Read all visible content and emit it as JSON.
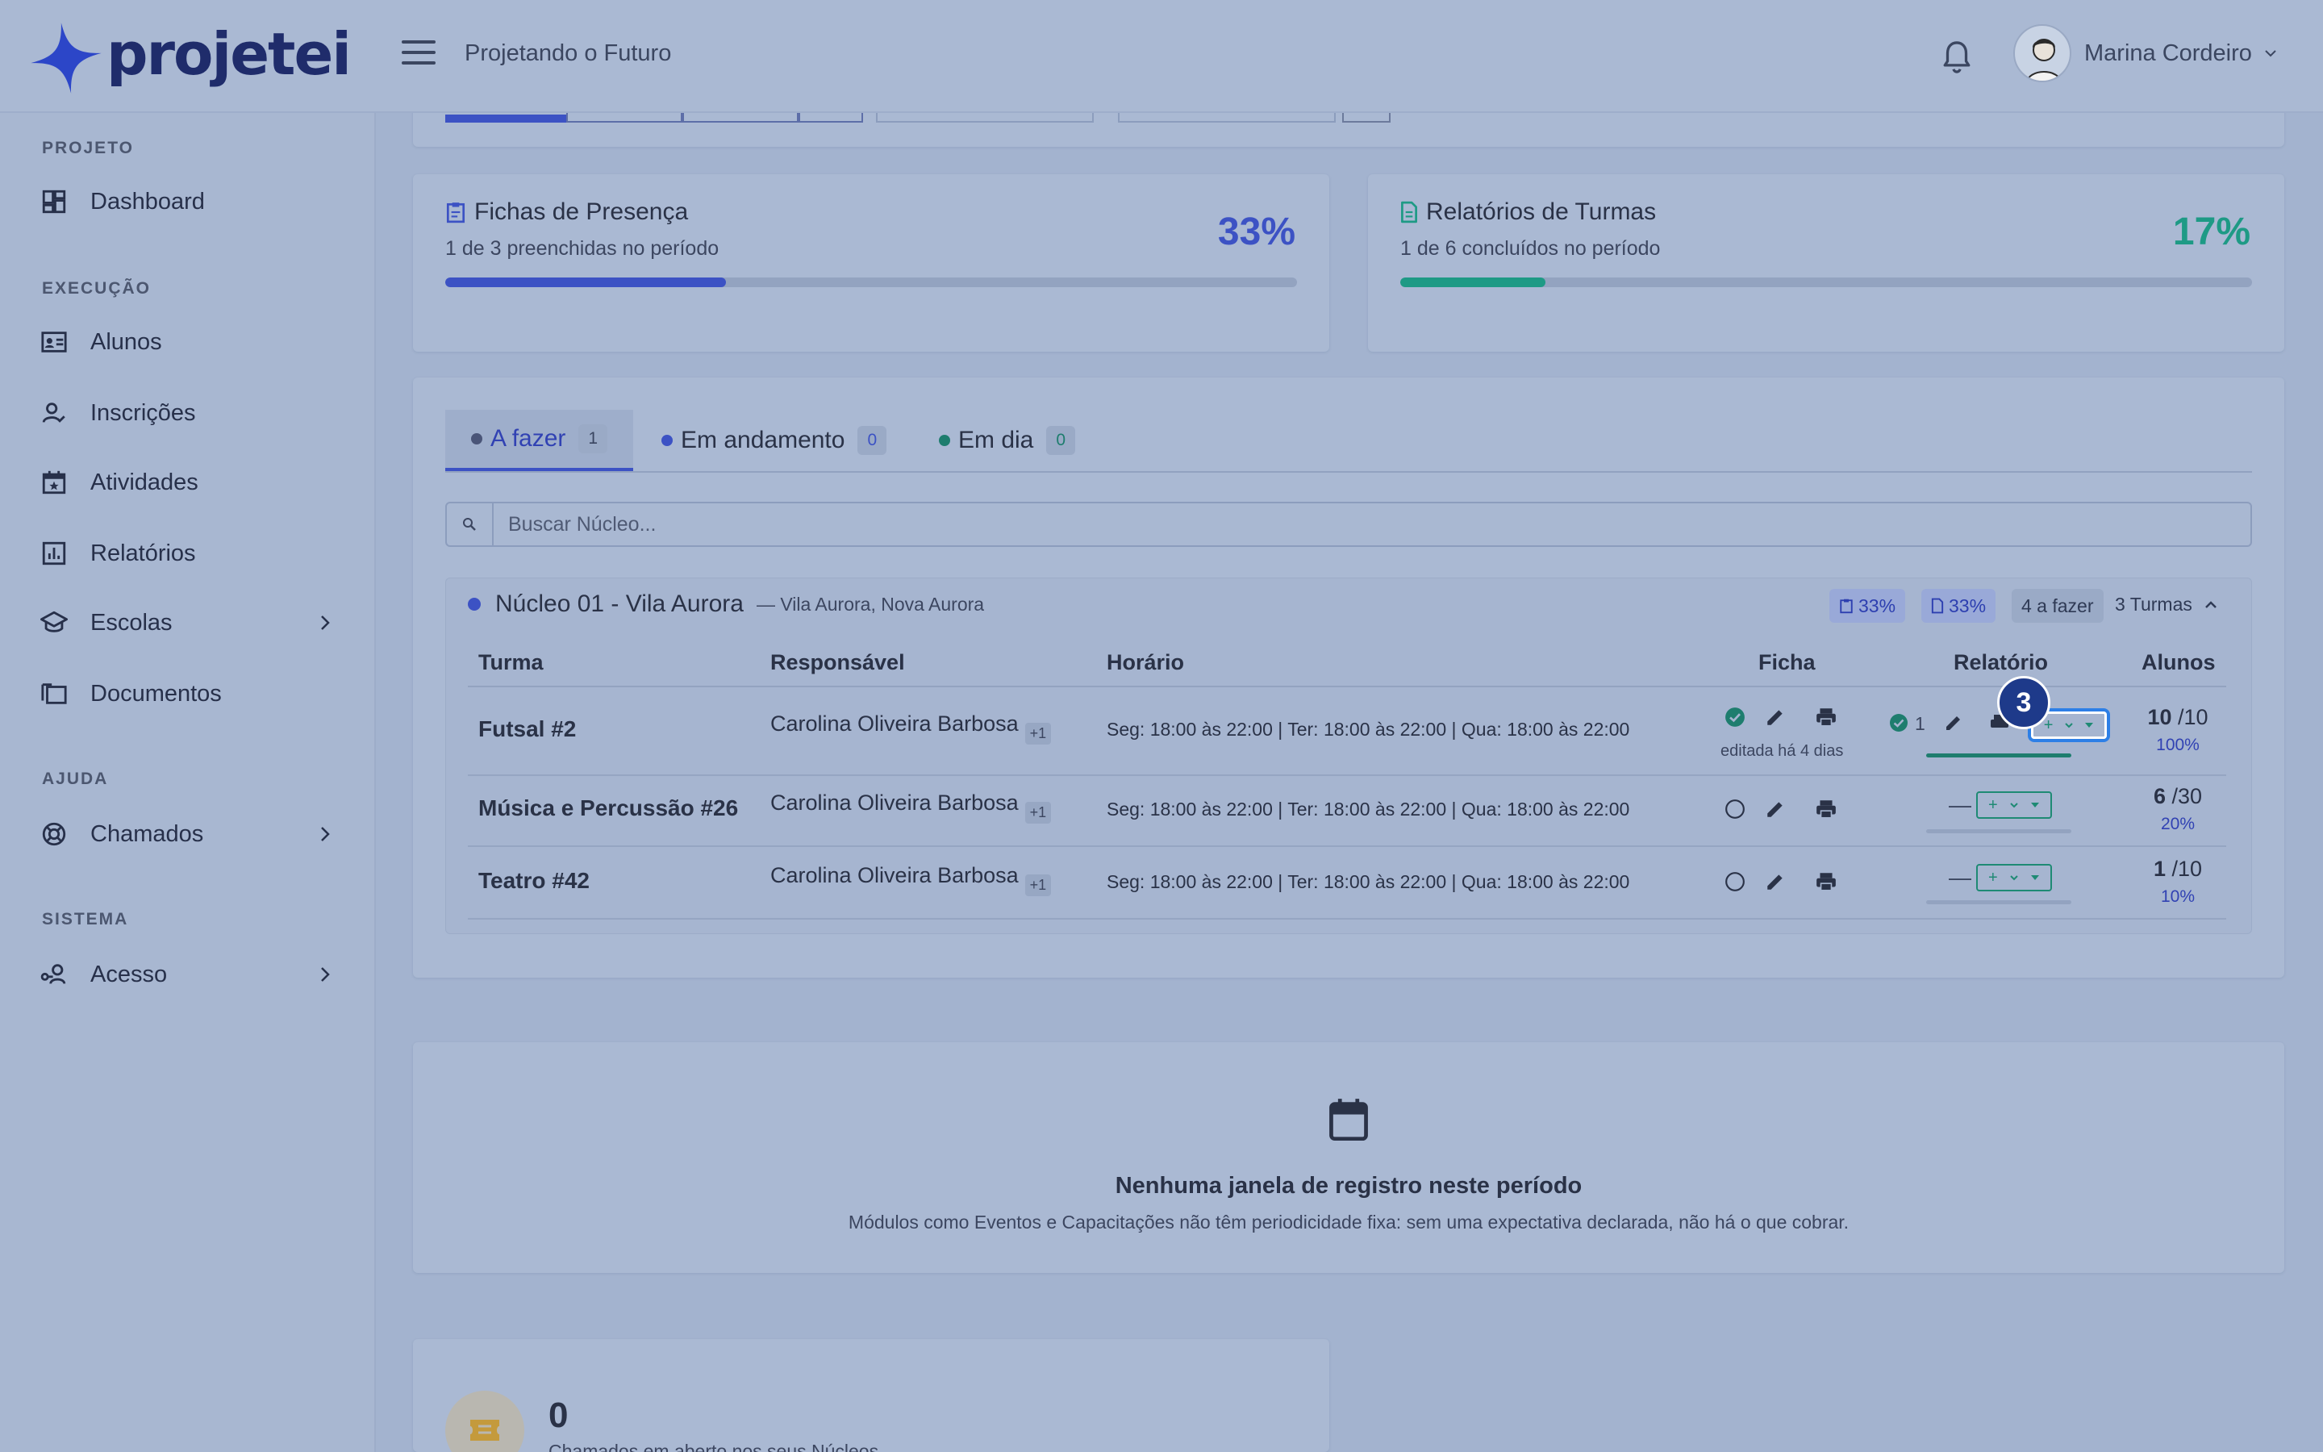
{
  "brand": {
    "name": "projetei",
    "color": "#1f2c6b",
    "accent": "#3c52c4"
  },
  "header": {
    "project": "Projetando o Futuro",
    "user_name": "Marina Cordeiro"
  },
  "sidebar": {
    "sections": [
      {
        "label": "PROJETO",
        "items": [
          {
            "label": "Dashboard",
            "icon": "dashboard-icon"
          }
        ]
      },
      {
        "label": "EXECUÇÃO",
        "items": [
          {
            "label": "Alunos",
            "icon": "id-card-icon"
          },
          {
            "label": "Inscrições",
            "icon": "user-check-icon"
          },
          {
            "label": "Atividades",
            "icon": "calendar-star-icon"
          },
          {
            "label": "Relatórios",
            "icon": "chart-icon"
          },
          {
            "label": "Escolas",
            "icon": "school-icon"
          },
          {
            "label": "Documentos",
            "icon": "folders-icon"
          }
        ]
      },
      {
        "label": "AJUDA",
        "items": [
          {
            "label": "Chamados",
            "icon": "lifebuoy-icon"
          }
        ]
      },
      {
        "label": "SISTEMA",
        "items": [
          {
            "label": "Acesso",
            "icon": "user-key-icon"
          }
        ]
      }
    ]
  },
  "stats": {
    "fichas": {
      "title": "Fichas de Presença",
      "subtitle": "1 de 3 preenchidas no período",
      "pct": "33%",
      "progress": 0.33,
      "color": "#3c52c4"
    },
    "relatorios": {
      "title": "Relatórios de Turmas",
      "subtitle": "1 de 6 concluídos no período",
      "pct": "17%",
      "progress": 0.17,
      "color": "#1e9a85"
    }
  },
  "tabs": [
    {
      "label": "A fazer",
      "count": "1",
      "dot": "#4a5578"
    },
    {
      "label": "Em andamento",
      "count": "0",
      "dot": "#3c52c4"
    },
    {
      "label": "Em dia",
      "count": "0",
      "dot": "#1e7d6e"
    }
  ],
  "search": {
    "placeholder": "Buscar Núcleo..."
  },
  "nucleo": {
    "name": "Núcleo 01 - Vila Aurora",
    "location": "— Vila Aurora, Nova Aurora",
    "chip_ficha": "33%",
    "chip_rel": "33%",
    "chip_todo": "4 a fazer",
    "turmas": "3 Turmas"
  },
  "table": {
    "headers": {
      "turma": "Turma",
      "responsavel": "Responsável",
      "horario": "Horário",
      "ficha": "Ficha",
      "relatorio": "Relatório",
      "alunos": "Alunos"
    },
    "rows": [
      {
        "turma": "Futsal #2",
        "responsavel": "Carolina Oliveira Barbosa",
        "extra": "+1",
        "horario": "Seg: 18:00 às 22:00 | Ter: 18:00 às 22:00 | Qua: 18:00 às 22:00",
        "ficha_edited": "editada há 4 dias",
        "rel_count": "1",
        "alunos": "10",
        "alunos_total": "/10",
        "alunos_pct": "100%",
        "rel_progress": 1.0
      },
      {
        "turma": "Música e Percussão #26",
        "responsavel": "Carolina Oliveira Barbosa",
        "extra": "+1",
        "horario": "Seg: 18:00 às 22:00 | Ter: 18:00 às 22:00 | Qua: 18:00 às 22:00",
        "rel_dash": "—",
        "alunos": "6",
        "alunos_total": "/30",
        "alunos_pct": "20%",
        "rel_progress": 0
      },
      {
        "turma": "Teatro #42",
        "responsavel": "Carolina Oliveira Barbosa",
        "extra": "+1",
        "horario": "Seg: 18:00 às 22:00 | Ter: 18:00 às 22:00 | Qua: 18:00 às 22:00",
        "rel_dash": "—",
        "alunos": "1",
        "alunos_total": "/10",
        "alunos_pct": "10%",
        "rel_progress": 0
      }
    ]
  },
  "step_badge": "3",
  "empty": {
    "title": "Nenhuma janela de registro neste período",
    "subtitle": "Módulos como Eventos e Capacitações não têm periodicidade fixa: sem uma expectativa declarada, não há o que cobrar."
  },
  "chamados": {
    "count": "0",
    "subtitle": "Chamados em aberto nos seus Núcleos"
  }
}
